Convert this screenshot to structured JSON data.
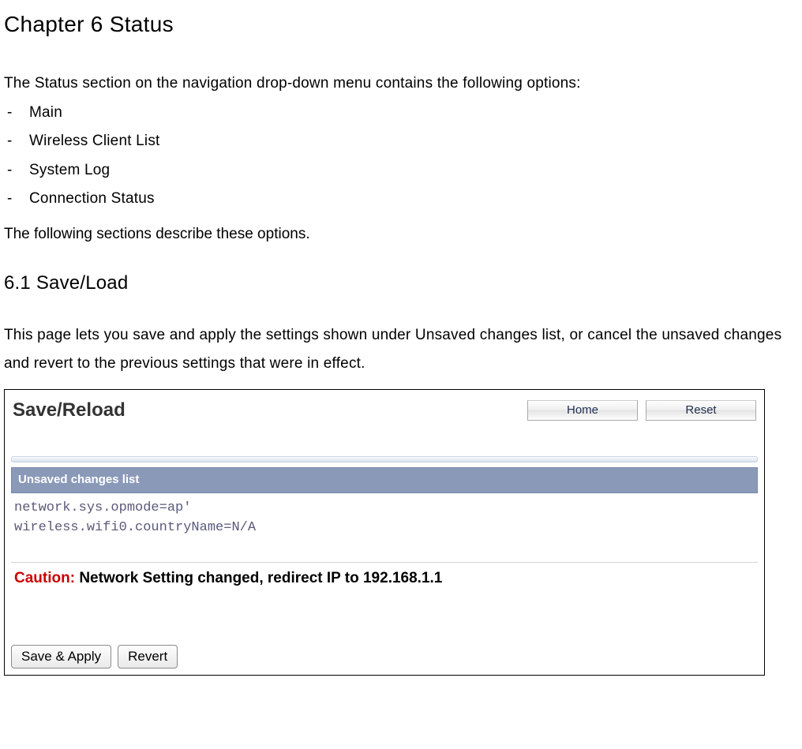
{
  "chapter_title": "Chapter 6 Status",
  "intro": "The Status section on the navigation drop-down menu contains the following options:",
  "options": [
    "Main",
    "Wireless Client List",
    "System Log",
    "Connection Status"
  ],
  "desc": "The following sections describe these options.",
  "section_heading": "6.1 Save/Load",
  "section_text": "This page lets you save and apply the settings shown under Unsaved changes list, or cancel the unsaved changes and revert to the previous settings that were in effect.",
  "screenshot": {
    "title": "Save/Reload",
    "home_button": "Home",
    "reset_button": "Reset",
    "list_header": "Unsaved changes list",
    "code": "network.sys.opmode=ap'\nwireless.wifi0.countryName=N/A",
    "caution_label": "Caution:",
    "caution_text": "  Network Setting changed, redirect IP to 192.168.1.1",
    "save_apply": "Save & Apply",
    "revert": "Revert"
  }
}
